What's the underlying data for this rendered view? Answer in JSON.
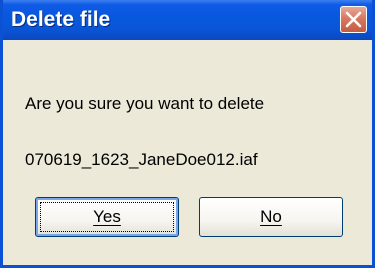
{
  "dialog": {
    "title": "Delete file",
    "message_line1": "Are you sure you want to delete",
    "message_line2": "070619_1623_JaneDoe012.iaf",
    "buttons": {
      "yes_label": "Yes",
      "no_label": "No"
    },
    "icons": {
      "close": "close-icon"
    },
    "colors": {
      "titlebar": "#0a56d8",
      "body": "#ece9d8",
      "close_button": "#d87862"
    }
  }
}
